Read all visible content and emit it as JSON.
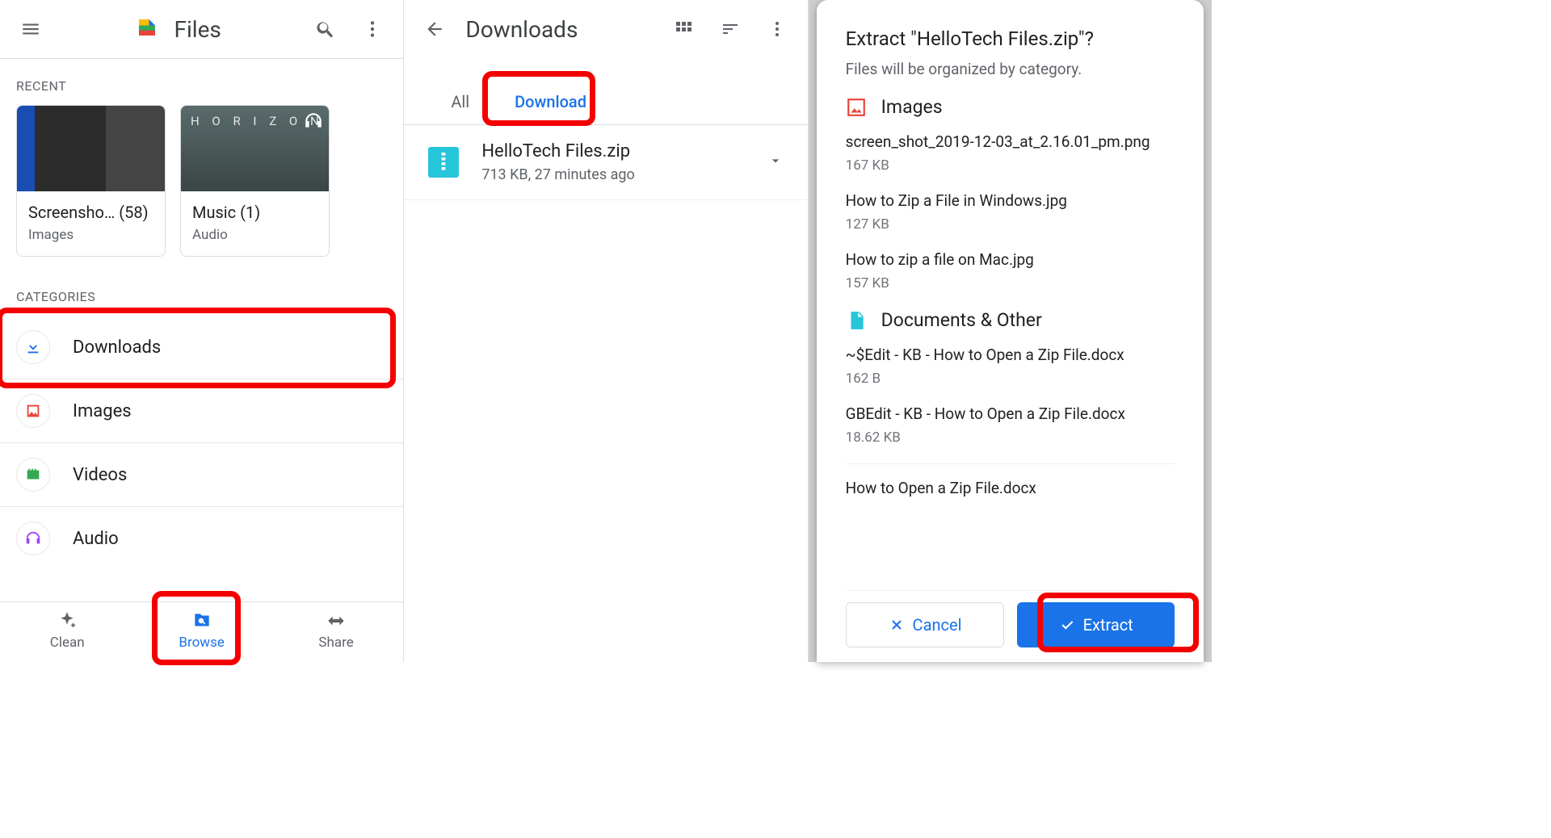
{
  "screen1": {
    "title": "Files",
    "recent_label": "RECENT",
    "recent": [
      {
        "title": "Screensho… (58)",
        "sub": "Images"
      },
      {
        "title": "Music (1)",
        "sub": "Audio",
        "thumb_text": "H O R I Z O N"
      }
    ],
    "categories_label": "CATEGORIES",
    "categories": [
      {
        "label": "Downloads"
      },
      {
        "label": "Images"
      },
      {
        "label": "Videos"
      },
      {
        "label": "Audio"
      }
    ],
    "nav": [
      {
        "label": "Clean"
      },
      {
        "label": "Browse"
      },
      {
        "label": "Share"
      }
    ]
  },
  "screen2": {
    "title": "Downloads",
    "tabs": [
      {
        "label": "All"
      },
      {
        "label": "Download"
      }
    ],
    "file": {
      "name": "HelloTech Files.zip",
      "meta": "713 KB, 27 minutes ago"
    }
  },
  "screen3": {
    "title": "Extract \"HelloTech Files.zip\"?",
    "subtitle": "Files will be organized by category.",
    "groups": [
      {
        "title": "Images",
        "items": [
          {
            "name": "screen_shot_2019-12-03_at_2.16.01_pm.png",
            "size": "167 KB"
          },
          {
            "name": "How to Zip a File in Windows.jpg",
            "size": "127 KB"
          },
          {
            "name": "How to zip a file on Mac.jpg",
            "size": "157 KB"
          }
        ]
      },
      {
        "title": "Documents & Other",
        "items": [
          {
            "name": "~$Edit - KB - How to Open a Zip File.docx",
            "size": "162 B"
          },
          {
            "name": "GBEdit - KB - How to Open a Zip File.docx",
            "size": "18.62 KB"
          },
          {
            "name": "How to Open a Zip File.docx",
            "size": ""
          }
        ]
      }
    ],
    "cancel": "Cancel",
    "extract": "Extract"
  }
}
